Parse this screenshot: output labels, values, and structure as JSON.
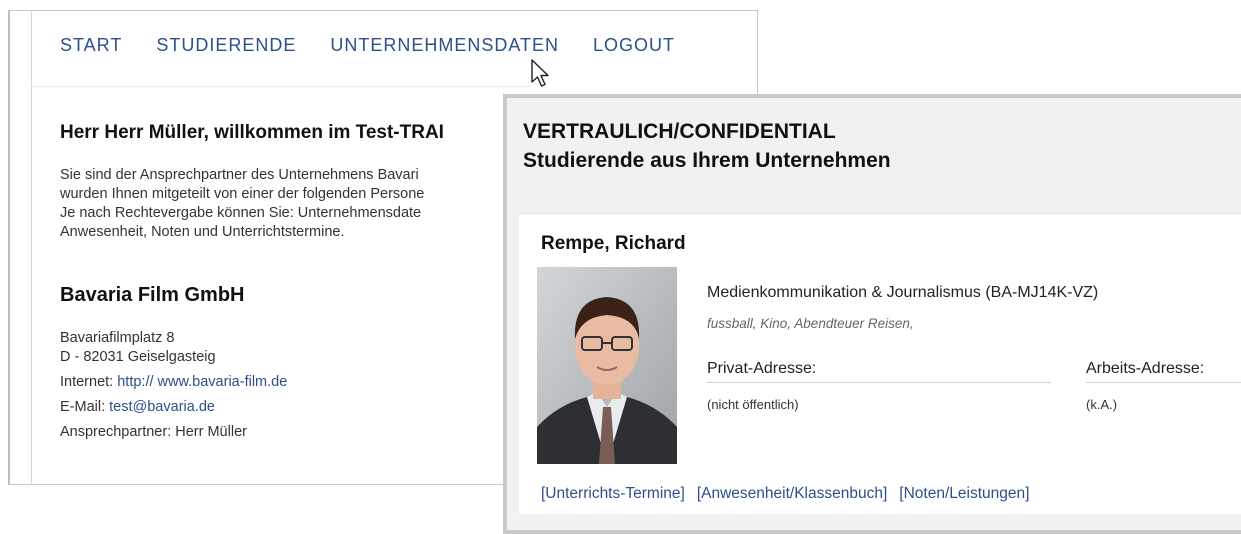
{
  "nav": {
    "start": "START",
    "studierende": "STUDIERENDE",
    "unternehmensdaten": "UNTERNEHMENSDATEN",
    "logout": "LOGOUT"
  },
  "welcome": {
    "title": "Herr Herr Müller, willkommen im Test-TRAI",
    "lines": [
      "Sie sind der Ansprechpartner des Unternehmens Bavari",
      "wurden Ihnen mitgeteilt von einer der folgenden Persone",
      "Je nach Rechtevergabe können Sie: Unternehmensdate",
      "Anwesenheit, Noten und Unterrichtstermine."
    ]
  },
  "company": {
    "name": "Bavaria Film GmbH",
    "street": "Bavariafilmplatz 8",
    "city": "D - 82031 Geiselgasteig",
    "internet_label": "Internet:",
    "internet_url": "http:// www.bavaria-film.de",
    "email_label": "E-Mail:",
    "email": "test@bavaria.de",
    "contact": "Ansprechpartner: Herr Müller"
  },
  "panel": {
    "confidential": "VERTRAULICH/CONFIDENTIAL",
    "subtitle": "Studierende aus Ihrem Unternehmen",
    "student": {
      "name": "Rempe, Richard",
      "program": "Medienkommunikation & Journalismus (BA-MJ14K-VZ)",
      "hobbies": "fussball, Kino, Abendteuer Reisen,",
      "private_label": "Privat-Adresse:",
      "private_value": "(nicht öffentlich)",
      "work_label": "Arbeits-Adresse:",
      "work_value": "(k.A.)"
    },
    "links": {
      "termine": "[Unterrichts-Termine]",
      "anwesenheit": "[Anwesenheit/Klassenbuch]",
      "noten": "[Noten/Leistungen]"
    }
  },
  "colors": {
    "link": "#2d4f8a",
    "panel_border": "#c9c9c9",
    "panel_bg": "#f1f1f1"
  }
}
